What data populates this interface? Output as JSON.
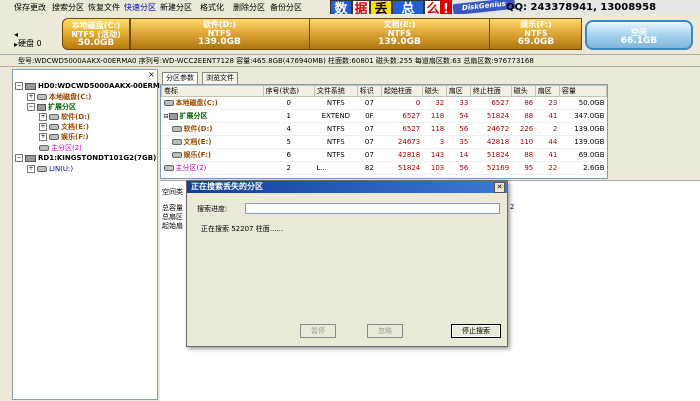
{
  "toolbar": {
    "items": [
      "保存更改",
      "搜索分区",
      "恢复文件",
      "快速分区",
      "新建分区",
      "格式化",
      "删除分区",
      "备份分区"
    ]
  },
  "banner": {
    "chars": [
      "数",
      "据",
      "丢",
      "总",
      "么"
    ],
    "brand": "DiskGenius",
    "contact": "QQ: 243378941, 13008958"
  },
  "disk_bar": {
    "disk_label": "硬盘 0",
    "segments": [
      {
        "name": "本地磁盘(C:)",
        "fs": "NTFS (活动)",
        "size": "50.0GB"
      },
      {
        "name": "软件(D:)",
        "fs": "NTFS",
        "size": "139.0GB"
      },
      {
        "name": "文档(E:)",
        "fs": "NTFS",
        "size": "139.0GB"
      },
      {
        "name": "娱乐(F:)",
        "fs": "NTFS",
        "size": "69.0GB"
      },
      {
        "name": "空闲",
        "fs": "",
        "size": "66.1GB"
      }
    ]
  },
  "info_line": "型号:WDCWD5000AAKX-00ERMA0  序列号:WD-WCC2EENT7128  容量:465.8GB(476940MB)  柱面数:60801  磁头数:255  每道扇区数:63  总扇区数:976773168",
  "tree": {
    "nodes": [
      {
        "label": "HD0:WDCWD5000AAKX-00ERMA0"
      },
      {
        "label": "本地磁盘(C:)"
      },
      {
        "label": "扩展分区"
      },
      {
        "label": "软件(D:)"
      },
      {
        "label": "文档(E:)"
      },
      {
        "label": "娱乐(F:)"
      },
      {
        "label": "主分区(2)"
      },
      {
        "label": "RD1:KINGSTONDT101G2(7GB)"
      },
      {
        "label": "LIN(U:)"
      }
    ]
  },
  "tabs": [
    "分区参数",
    "浏览文件"
  ],
  "table": {
    "headers": [
      "卷标",
      "序号(状态)",
      "文件系统",
      "标识",
      "起始柱面",
      "磁头",
      "扇区",
      "终止柱面",
      "磁头",
      "扇区",
      "容量"
    ],
    "rows": [
      [
        "本地磁盘(C:)",
        "0",
        "NTFS",
        "07",
        "0",
        "32",
        "33",
        "6527",
        "86",
        "23",
        "50.0GB"
      ],
      [
        "扩展分区",
        "1",
        "EXTEND",
        "0F",
        "6527",
        "118",
        "54",
        "51824",
        "88",
        "41",
        "347.0GB"
      ],
      [
        "软件(D:)",
        "4",
        "NTFS",
        "07",
        "6527",
        "118",
        "56",
        "24672",
        "226",
        "2",
        "139.0GB"
      ],
      [
        "文档(E:)",
        "5",
        "NTFS",
        "07",
        "24673",
        "3",
        "35",
        "42818",
        "110",
        "44",
        "139.0GB"
      ],
      [
        "娱乐(F:)",
        "6",
        "NTFS",
        "07",
        "42818",
        "143",
        "14",
        "51824",
        "88",
        "41",
        "69.0GB"
      ],
      [
        "主分区(2)",
        "2",
        "L...",
        "82",
        "51824",
        "103",
        "56",
        "52169",
        "95",
        "22",
        "2.6GB"
      ]
    ]
  },
  "lower_panel": {
    "space_label": "空间类",
    "total_capacity_label": "总容量",
    "total_sectors_label": "总扇区",
    "start_sector_label": "起始扇",
    "right_value": "2"
  },
  "dialog": {
    "title": "正在搜索丢失的分区",
    "progress_label": "搜索进度:",
    "status": "正在搜索 52207 柱面......",
    "buttons": {
      "pause": "暂停",
      "ignore": "忽略",
      "stop": "停止搜索"
    }
  }
}
